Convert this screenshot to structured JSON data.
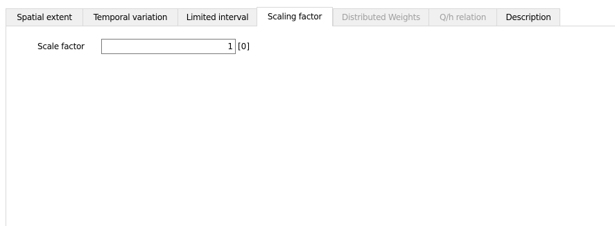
{
  "tabs": [
    {
      "label": "Spatial extent",
      "state": "normal"
    },
    {
      "label": "Temporal variation",
      "state": "normal"
    },
    {
      "label": "Limited interval",
      "state": "normal"
    },
    {
      "label": "Scaling factor",
      "state": "active"
    },
    {
      "label": "Distributed Weights",
      "state": "disabled"
    },
    {
      "label": "Q/h relation",
      "state": "disabled"
    },
    {
      "label": "Description",
      "state": "normal"
    }
  ],
  "scaling": {
    "label": "Scale factor",
    "value": "1",
    "unit": "[0]"
  },
  "colors": {
    "border": "#d9d9d9",
    "tab_background": "#f0f0f0",
    "disabled_text": "#a0a0a0",
    "input_border": "#7a7a7a"
  }
}
